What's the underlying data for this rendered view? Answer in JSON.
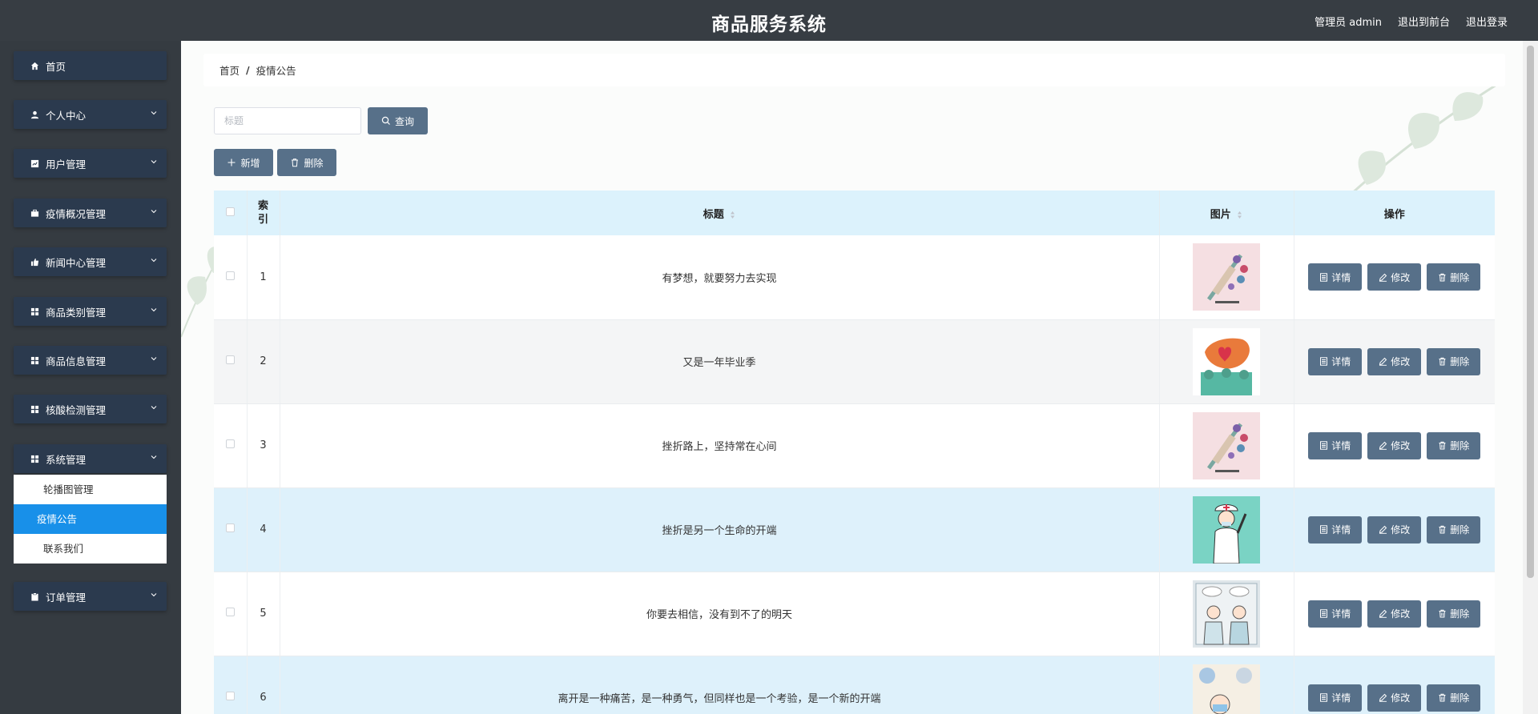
{
  "app": {
    "title": "商品服务系统",
    "user_label": "管理员 admin",
    "to_front": "退出到前台",
    "logout": "退出登录"
  },
  "sidebar": {
    "items": [
      {
        "label": "首页",
        "icon": "home-icon"
      },
      {
        "label": "个人中心",
        "icon": "user-icon"
      },
      {
        "label": "用户管理",
        "icon": "chart-icon"
      },
      {
        "label": "疫情概况管理",
        "icon": "briefcase-icon"
      },
      {
        "label": "新闻中心管理",
        "icon": "thumbsup-icon"
      },
      {
        "label": "商品类别管理",
        "icon": "grid-icon"
      },
      {
        "label": "商品信息管理",
        "icon": "grid-icon"
      },
      {
        "label": "核酸检测管理",
        "icon": "grid-icon"
      },
      {
        "label": "系统管理",
        "icon": "grid-icon"
      },
      {
        "label": "订单管理",
        "icon": "clipboard-icon"
      }
    ],
    "submenu": [
      {
        "label": "轮播图管理"
      },
      {
        "label": "疫情公告"
      },
      {
        "label": "联系我们"
      }
    ]
  },
  "breadcrumb": {
    "home": "首页",
    "separator": "/",
    "current": "疫情公告"
  },
  "search": {
    "placeholder": "标题",
    "button": "查询"
  },
  "actions": {
    "add": "新增",
    "delete": "删除"
  },
  "table": {
    "headers": {
      "index": "索引",
      "title": "标题",
      "image": "图片",
      "ops": "操作"
    },
    "op_labels": {
      "detail": "详情",
      "edit": "修改",
      "delete": "删除"
    },
    "rows": [
      {
        "index": "1",
        "title": "有梦想，就要努力去实现",
        "image": "vaccine-illustration"
      },
      {
        "index": "2",
        "title": "又是一年毕业季",
        "image": "china-map-illustration"
      },
      {
        "index": "3",
        "title": "挫折路上，坚持常在心间",
        "image": "vaccine-illustration"
      },
      {
        "index": "4",
        "title": "挫折是另一个生命的开端",
        "image": "doctor-illustration"
      },
      {
        "index": "5",
        "title": "你要去相信，没有到不了的明天",
        "image": "medical-comic-illustration"
      },
      {
        "index": "6",
        "title": "离开是一种痛苦，是一种勇气，但同样也是一个考验，是一个新的开端",
        "image": "mask-illustration"
      }
    ]
  },
  "colors": {
    "topbar": "#373d43",
    "sidebar": "#353b41",
    "menu_item": "#2b3a4e",
    "active_sub": "#1890e9",
    "button": "#577089",
    "table_header": "#dcf2fc",
    "row_highlight": "#def1fb"
  }
}
